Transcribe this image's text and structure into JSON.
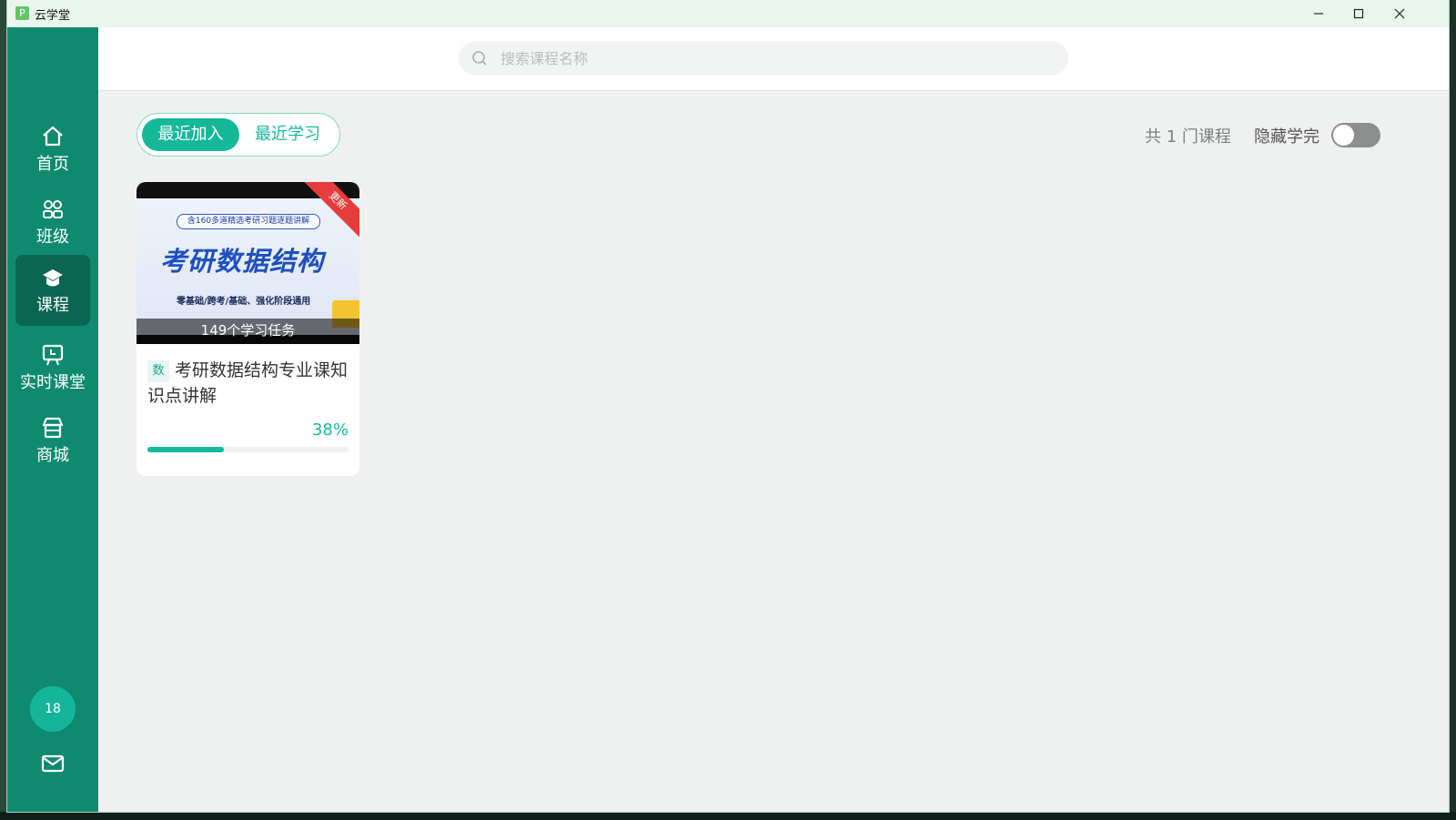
{
  "window": {
    "title": "云学堂",
    "logo_glyph": "P"
  },
  "sidebar": {
    "items": [
      {
        "label": "首页",
        "icon": "home-icon",
        "active": false
      },
      {
        "label": "班级",
        "icon": "group-icon",
        "active": false
      },
      {
        "label": "课程",
        "icon": "graduation-cap-icon",
        "active": true
      },
      {
        "label": "实时课堂",
        "icon": "live-class-icon",
        "active": false
      },
      {
        "label": "商城",
        "icon": "store-icon",
        "active": false
      }
    ],
    "badge_number": "18"
  },
  "search": {
    "placeholder": "搜索课程名称",
    "value": ""
  },
  "tabs": {
    "recent_joined": "最近加入",
    "recent_studied": "最近学习",
    "selected": "最近加入"
  },
  "summary": {
    "count_text": "共 1 门课程",
    "hide_completed_label": "隐藏学完",
    "hide_completed_on": false
  },
  "course": {
    "ribbon": "更新",
    "cover_pill": "含160多道精选考研习题逐题讲解",
    "cover_title": "考研数据结构",
    "cover_subtitle": "零基础/跨考/基础、强化阶段通用",
    "tasks": "149个学习任务",
    "subject_tag": "数",
    "title": "考研数据结构专业课知识点讲解",
    "progress_percent": 38,
    "progress_text": "38%"
  },
  "colors": {
    "sidebar": "#0f8a6f",
    "sidebar_active": "#0a6553",
    "accent": "#16b89a",
    "ribbon": "#e73c3c"
  }
}
